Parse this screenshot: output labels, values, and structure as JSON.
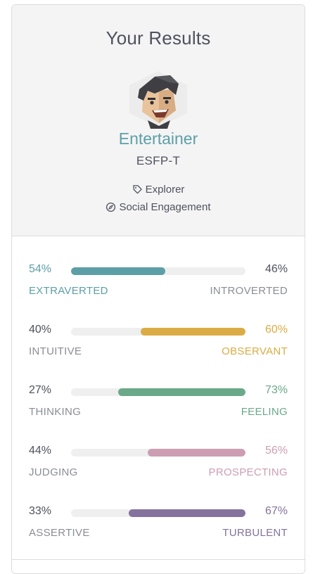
{
  "header": {
    "title": "Your Results",
    "type_name": "Entertainer",
    "type_code": "ESFP-T",
    "role": "Explorer",
    "strategy": "Social Engagement"
  },
  "colors": {
    "extraverted": "#5d9fa7",
    "observant": "#d9ac45",
    "feeling": "#6aa989",
    "prospecting": "#cd9eb3",
    "turbulent": "#85729d"
  },
  "traits": [
    {
      "left_pct": "54%",
      "right_pct": "46%",
      "left_label": "EXTRAVERTED",
      "right_label": "INTROVERTED",
      "dominant": "left",
      "value": 54
    },
    {
      "left_pct": "40%",
      "right_pct": "60%",
      "left_label": "INTUITIVE",
      "right_label": "OBSERVANT",
      "dominant": "right",
      "value": 60
    },
    {
      "left_pct": "27%",
      "right_pct": "73%",
      "left_label": "THINKING",
      "right_label": "FEELING",
      "dominant": "right",
      "value": 73
    },
    {
      "left_pct": "44%",
      "right_pct": "56%",
      "left_label": "JUDGING",
      "right_label": "PROSPECTING",
      "dominant": "right",
      "value": 56
    },
    {
      "left_pct": "33%",
      "right_pct": "67%",
      "left_label": "ASSERTIVE",
      "right_label": "TURBULENT",
      "dominant": "right",
      "value": 67
    }
  ]
}
